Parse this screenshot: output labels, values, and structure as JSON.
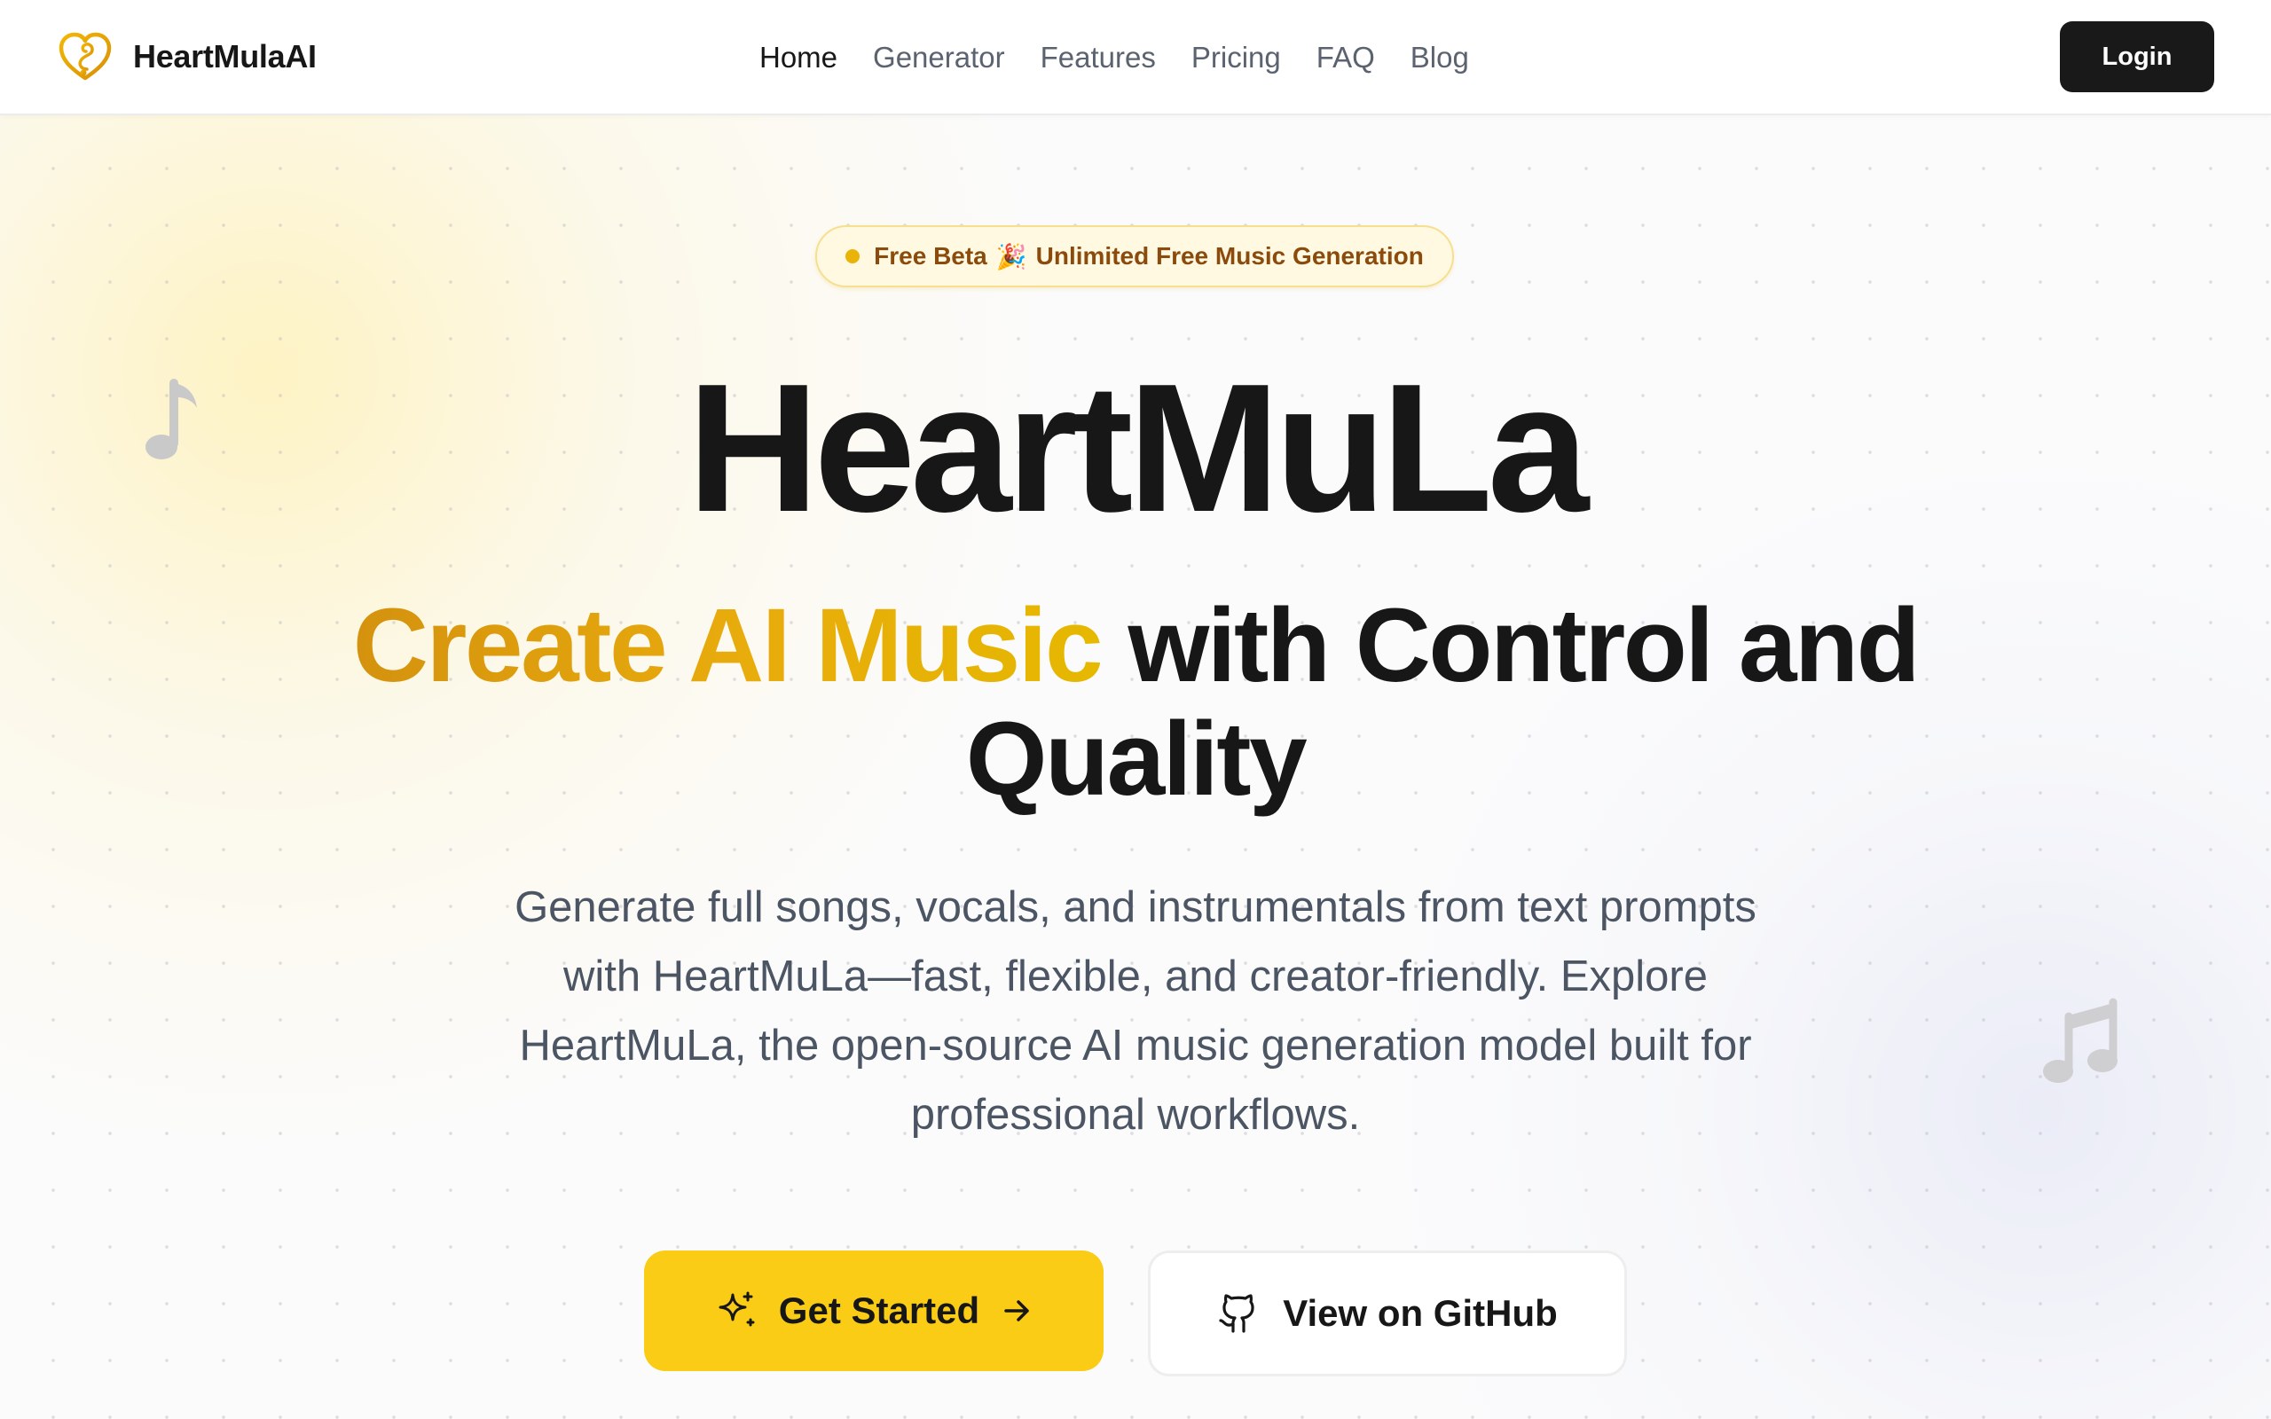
{
  "header": {
    "brand_name": "HeartMulaAI",
    "nav": [
      "Home",
      "Generator",
      "Features",
      "Pricing",
      "FAQ",
      "Blog"
    ],
    "active_nav": "Home",
    "login_label": "Login"
  },
  "hero": {
    "badge": {
      "text_left": "Free Beta",
      "emoji": "🎉",
      "text_right": "Unlimited Free Music Generation"
    },
    "title": "HeartMuLa",
    "subtitle_accent": "Create AI Music",
    "subtitle_rest": " with Control and Quality",
    "description": "Generate full songs, vocals, and instrumentals from text prompts with HeartMuLa—fast, flexible, and creator-friendly. Explore HeartMuLa, the open-source AI music generation model built for professional workflows.",
    "primary_cta": "Get Started",
    "secondary_cta": "View on GitHub"
  },
  "colors": {
    "accent": "#facc15",
    "accent_text": "#e0a10d",
    "dark": "#191919",
    "badge_bg": "#fff9e2",
    "badge_text": "#8a4b0c"
  },
  "icons": {
    "logo": "heart-music-logo-icon",
    "badge_dot": "dot-icon",
    "primary_cta": "sparkles-icon",
    "primary_cta_trailing": "arrow-right-icon",
    "secondary_cta": "github-icon",
    "decorations": [
      "music-note-icon",
      "music-notes-icon"
    ]
  }
}
